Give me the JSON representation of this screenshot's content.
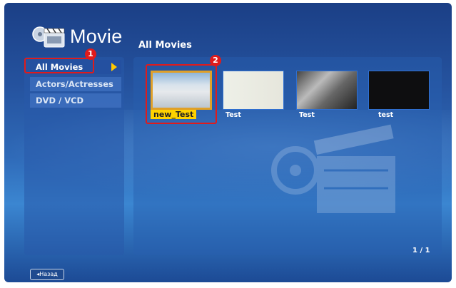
{
  "header": {
    "app_title": "Movie",
    "section_title": "All Movies"
  },
  "sidebar": {
    "items": [
      {
        "label": "All Movies"
      },
      {
        "label": "Actors/Actresses"
      },
      {
        "label": "DVD / VCD"
      }
    ]
  },
  "movies": [
    {
      "title": "new_Test",
      "selected": true
    },
    {
      "title": "Test"
    },
    {
      "title": "Test"
    },
    {
      "title": "test"
    }
  ],
  "pagination": {
    "text": "1 / 1"
  },
  "footer": {
    "back_label": "◂Назад"
  },
  "callouts": {
    "one": "1",
    "two": "2"
  },
  "colors": {
    "accent_highlight": "#ffd200",
    "selected_border": "#e0a028",
    "callout_red": "#e01b1b"
  }
}
